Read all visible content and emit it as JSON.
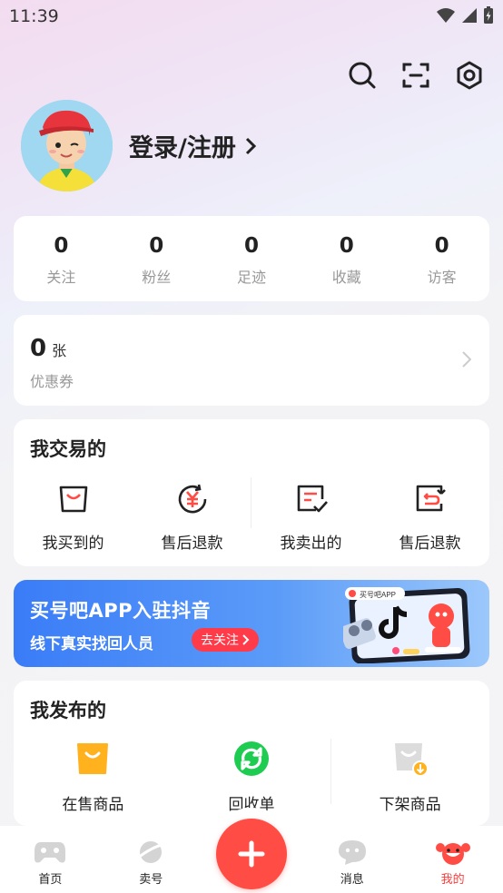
{
  "status": {
    "time": "11:39"
  },
  "profile": {
    "login_label": "登录/注册"
  },
  "stats": [
    {
      "value": "0",
      "label": "关注"
    },
    {
      "value": "0",
      "label": "粉丝"
    },
    {
      "value": "0",
      "label": "足迹"
    },
    {
      "value": "0",
      "label": "收藏"
    },
    {
      "value": "0",
      "label": "访客"
    }
  ],
  "coupon": {
    "count": "0",
    "unit": "张",
    "label": "优惠券"
  },
  "trade": {
    "title": "我交易的",
    "items": [
      {
        "label": "我买到的",
        "icon": "bag-icon"
      },
      {
        "label": "售后退款",
        "icon": "refund-yen-icon"
      },
      {
        "label": "我卖出的",
        "icon": "sold-check-icon"
      },
      {
        "label": "售后退款",
        "icon": "refund-return-icon"
      }
    ]
  },
  "banner": {
    "title": "买号吧APP入驻抖音",
    "subtitle": "线下真实找回人员",
    "button": "去关注",
    "badge_text": "买号吧APP"
  },
  "publish": {
    "title": "我发布的",
    "items": [
      {
        "label": "在售商品",
        "icon": "on-sale-bag-icon"
      },
      {
        "label": "回收单",
        "icon": "recycle-icon"
      },
      {
        "label": "下架商品",
        "icon": "off-shelf-icon"
      }
    ]
  },
  "tabbar": {
    "items": [
      {
        "label": "首页",
        "icon": "gamepad-icon"
      },
      {
        "label": "卖号",
        "icon": "planet-icon"
      },
      {
        "label": "消息",
        "icon": "chat-icon"
      },
      {
        "label": "我的",
        "icon": "mascot-icon"
      }
    ]
  },
  "colors": {
    "accent": "#ff4c44",
    "banner": "#3a7cf7",
    "green": "#1fcc52",
    "yellow": "#ffb21e"
  }
}
